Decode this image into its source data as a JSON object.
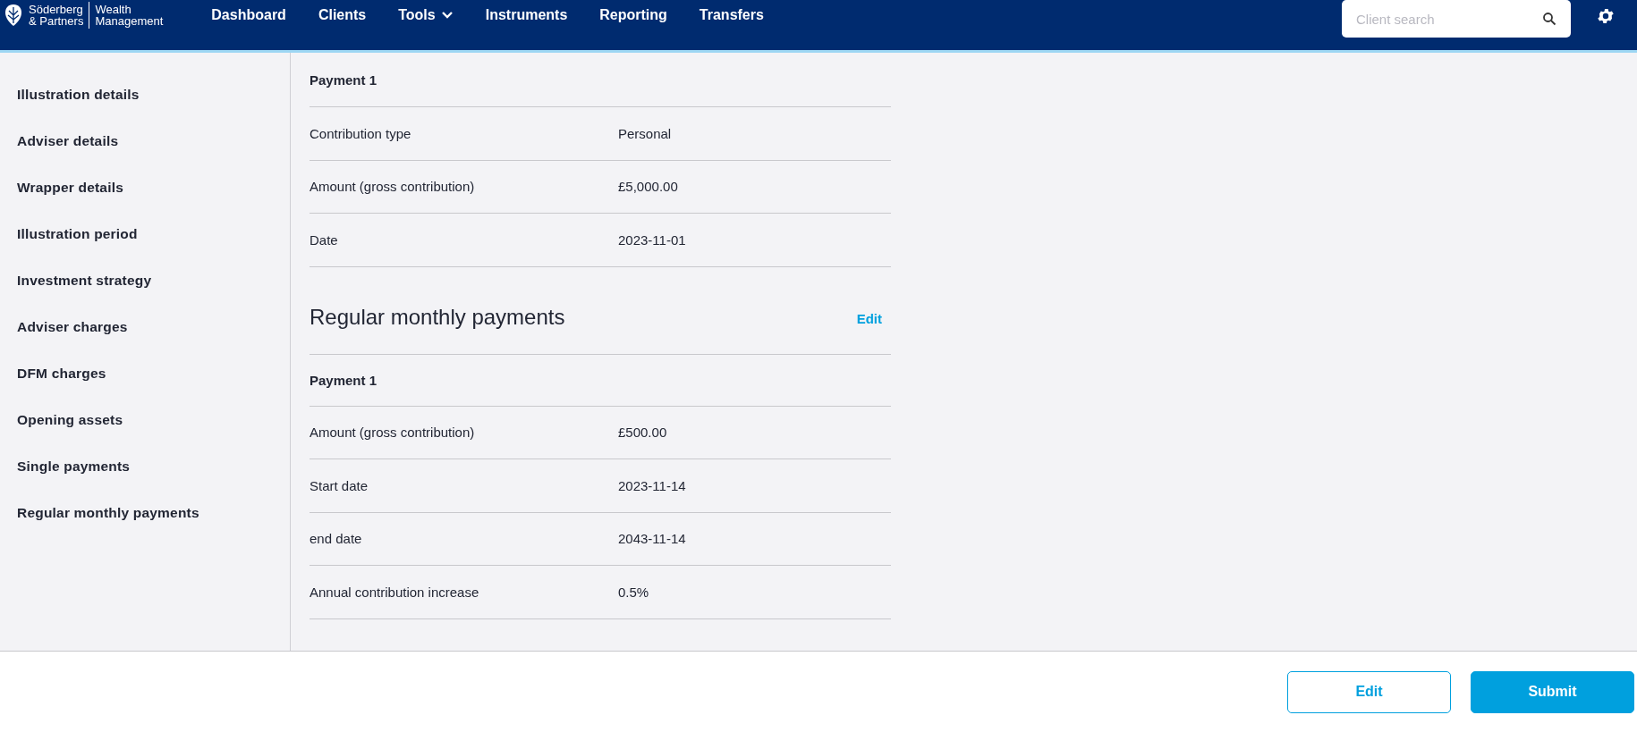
{
  "header": {
    "logo": {
      "brand_line1": "Söderberg",
      "brand_line2": "& Partners",
      "division_line1": "Wealth",
      "division_line2": "Management"
    },
    "nav": [
      {
        "label": "Dashboard",
        "dropdown": false
      },
      {
        "label": "Clients",
        "dropdown": false
      },
      {
        "label": "Tools",
        "dropdown": true
      },
      {
        "label": "Instruments",
        "dropdown": false
      },
      {
        "label": "Reporting",
        "dropdown": false
      },
      {
        "label": "Transfers",
        "dropdown": false
      }
    ],
    "search": {
      "placeholder": "Client search"
    }
  },
  "sidebar": {
    "items": [
      "Illustration details",
      "Adviser details",
      "Wrapper details",
      "Illustration period",
      "Investment strategy",
      "Adviser charges",
      "DFM charges",
      "Opening assets",
      "Single payments",
      "Regular monthly payments"
    ]
  },
  "sections": [
    {
      "payments": [
        {
          "title": "Payment 1",
          "rows": [
            {
              "label": "Contribution type",
              "value": "Personal"
            },
            {
              "label": "Amount (gross contribution)",
              "value": "£5,000.00"
            },
            {
              "label": "Date",
              "value": "2023-11-01"
            }
          ]
        }
      ]
    },
    {
      "title": "Regular monthly payments",
      "edit_link": "Edit",
      "payments": [
        {
          "title": "Payment 1",
          "rows": [
            {
              "label": "Amount (gross contribution)",
              "value": "£500.00"
            },
            {
              "label": "Start date",
              "value": "2023-11-14"
            },
            {
              "label": "end date",
              "value": "2043-11-14"
            },
            {
              "label": "Annual contribution increase",
              "value": "0.5%"
            }
          ]
        }
      ]
    }
  ],
  "footer": {
    "buttons": [
      {
        "label": "Edit",
        "kind": "secondary"
      },
      {
        "label": "Submit",
        "kind": "primary"
      }
    ]
  }
}
